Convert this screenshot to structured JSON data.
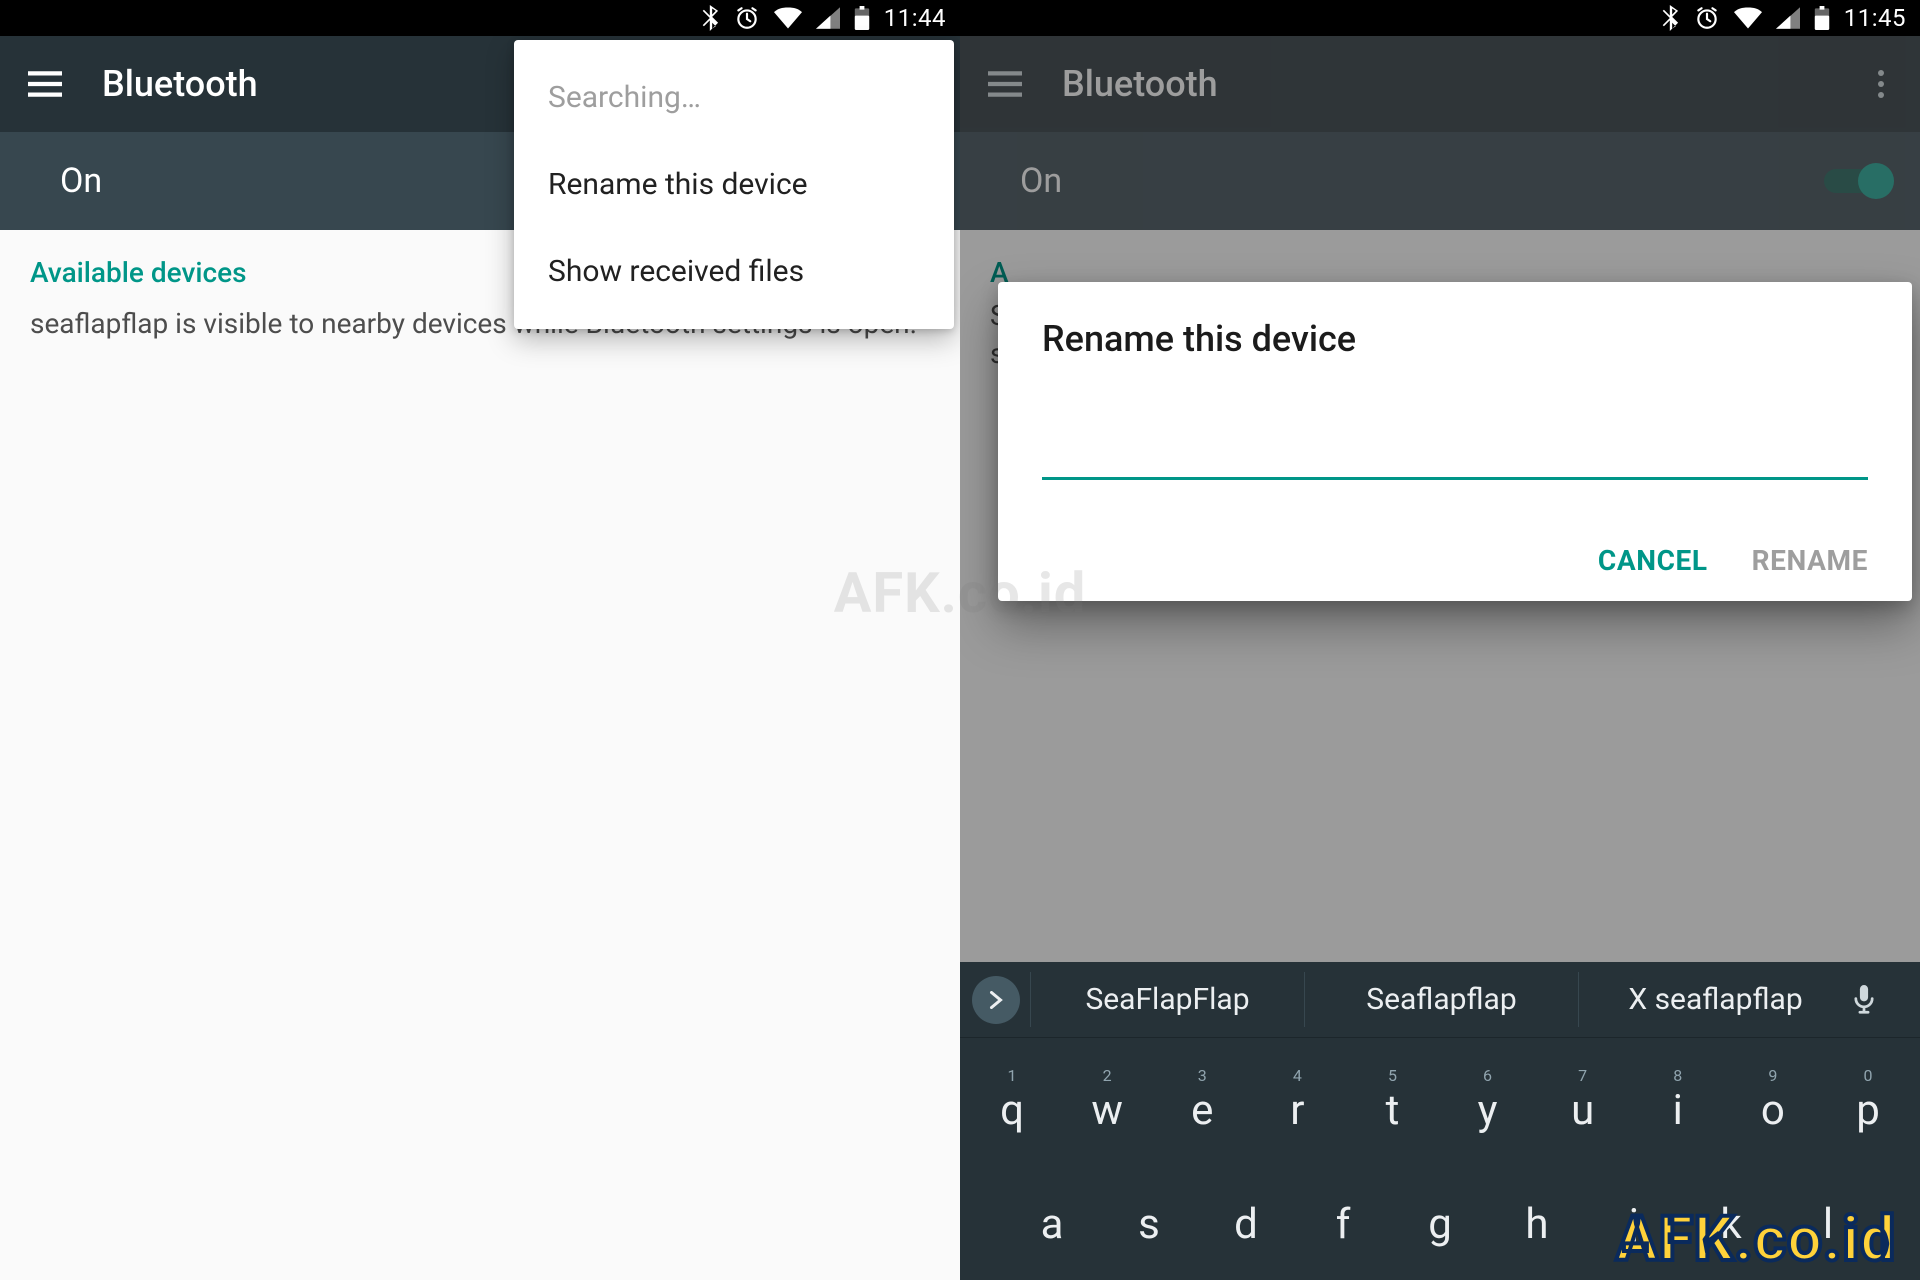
{
  "left": {
    "statusbar": {
      "time": "11:44"
    },
    "actionbar": {
      "title": "Bluetooth"
    },
    "onrow": {
      "label": "On"
    },
    "section": {
      "header": "Available devices",
      "body": "seaflapflap is visible to nearby devices while Bluetooth settings is open."
    },
    "popup": {
      "items": [
        {
          "label": "Searching…",
          "disabled": true
        },
        {
          "label": "Rename this device",
          "disabled": false
        },
        {
          "label": "Show received files",
          "disabled": false
        }
      ]
    }
  },
  "right": {
    "statusbar": {
      "time": "11:45"
    },
    "actionbar": {
      "title": "Bluetooth"
    },
    "onrow": {
      "label": "On"
    },
    "peek": {
      "header_initial": "A",
      "body_initials": "S\ns"
    },
    "dialog": {
      "title": "Rename this device",
      "value": "",
      "cancel": "CANCEL",
      "rename": "RENAME"
    },
    "keyboard": {
      "suggestions": [
        "SeaFlapFlap",
        "Seaflapflap",
        "X seaflapflap"
      ],
      "row1": [
        {
          "n": "1",
          "c": "q"
        },
        {
          "n": "2",
          "c": "w"
        },
        {
          "n": "3",
          "c": "e"
        },
        {
          "n": "4",
          "c": "r"
        },
        {
          "n": "5",
          "c": "t"
        },
        {
          "n": "6",
          "c": "y"
        },
        {
          "n": "7",
          "c": "u"
        },
        {
          "n": "8",
          "c": "i"
        },
        {
          "n": "9",
          "c": "o"
        },
        {
          "n": "0",
          "c": "p"
        }
      ],
      "row2": [
        {
          "c": "a"
        },
        {
          "c": "s"
        },
        {
          "c": "d"
        },
        {
          "c": "f"
        },
        {
          "c": "g"
        },
        {
          "c": "h"
        },
        {
          "c": "j"
        },
        {
          "c": "k"
        },
        {
          "c": "l"
        }
      ]
    }
  },
  "watermark": {
    "center": "AFK.co.id",
    "corner": "AFK.co.id"
  }
}
